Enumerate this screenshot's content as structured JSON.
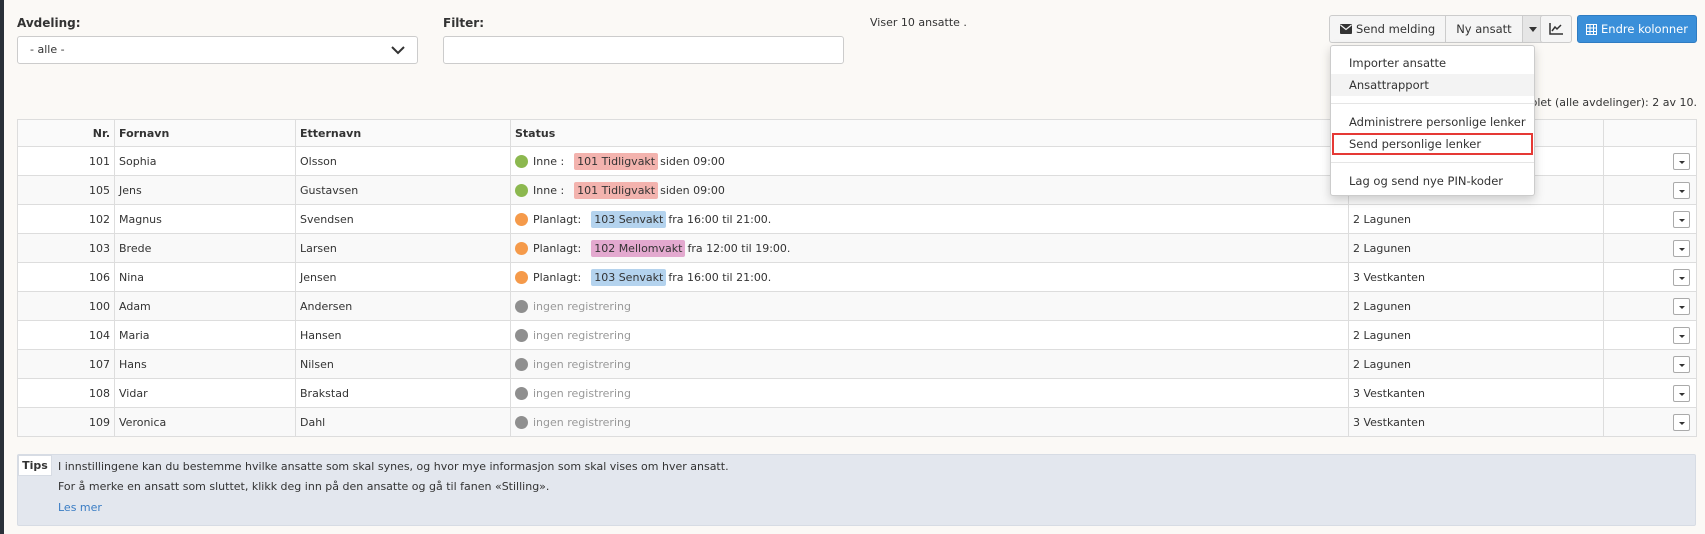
{
  "filters": {
    "department_label": "Avdeling:",
    "department_value": "- alle -",
    "filter_label": "Filter:",
    "filter_value": "",
    "count_text": "Viser 10 ansatte ."
  },
  "toolbar": {
    "send_message": "Send melding",
    "new_employee": "Ny ansatt",
    "edit_columns": "Endre kolonner"
  },
  "complete_text": "plet (alle avdelinger): 2 av 10.",
  "dropdown": {
    "items": [
      "Importer ansatte",
      "Ansattrapport",
      "Administrere personlige lenker",
      "Send personlige lenker",
      "Lag og send nye PIN-koder"
    ]
  },
  "table": {
    "headers": [
      "Nr.",
      "Fornavn",
      "Etternavn",
      "Status",
      "",
      ""
    ],
    "rows": [
      {
        "nr": "101",
        "first": "Sophia",
        "last": "Olsson",
        "status_label": "Inne :",
        "tag": "101 Tidligvakt",
        "tag_color": "#f3b3ae",
        "detail": "siden 09:00",
        "dot": "#8cb84f",
        "dept": ""
      },
      {
        "nr": "105",
        "first": "Jens",
        "last": "Gustavsen",
        "status_label": "Inne :",
        "tag": "101 Tidligvakt",
        "tag_color": "#f3b3ae",
        "detail": "siden 09:00",
        "dot": "#8cb84f",
        "dept": ""
      },
      {
        "nr": "102",
        "first": "Magnus",
        "last": "Svendsen",
        "status_label": "Planlagt:",
        "tag": "103 Senvakt",
        "tag_color": "#b4d3ee",
        "detail": "fra 16:00 til 21:00.",
        "dot": "#f59a4a",
        "dept": "2 Lagunen"
      },
      {
        "nr": "103",
        "first": "Brede",
        "last": "Larsen",
        "status_label": "Planlagt:",
        "tag": "102 Mellomvakt",
        "tag_color": "#e3a9cf",
        "detail": "fra 12:00 til 19:00.",
        "dot": "#f59a4a",
        "dept": "2 Lagunen"
      },
      {
        "nr": "106",
        "first": "Nina",
        "last": "Jensen",
        "status_label": "Planlagt:",
        "tag": "103 Senvakt",
        "tag_color": "#b4d3ee",
        "detail": "fra 16:00 til 21:00.",
        "dot": "#f59a4a",
        "dept": "3 Vestkanten"
      },
      {
        "nr": "100",
        "first": "Adam",
        "last": "Andersen",
        "status_label": "ingen registrering",
        "tag": "",
        "tag_color": "",
        "detail": "",
        "dot": "#8f8f8f",
        "dept": "2 Lagunen"
      },
      {
        "nr": "104",
        "first": "Maria",
        "last": "Hansen",
        "status_label": "ingen registrering",
        "tag": "",
        "tag_color": "",
        "detail": "",
        "dot": "#8f8f8f",
        "dept": "2 Lagunen"
      },
      {
        "nr": "107",
        "first": "Hans",
        "last": "Nilsen",
        "status_label": "ingen registrering",
        "tag": "",
        "tag_color": "",
        "detail": "",
        "dot": "#8f8f8f",
        "dept": "2 Lagunen"
      },
      {
        "nr": "108",
        "first": "Vidar",
        "last": "Brakstad",
        "status_label": "ingen registrering",
        "tag": "",
        "tag_color": "",
        "detail": "",
        "dot": "#8f8f8f",
        "dept": "3 Vestkanten"
      },
      {
        "nr": "109",
        "first": "Veronica",
        "last": "Dahl",
        "status_label": "ingen registrering",
        "tag": "",
        "tag_color": "",
        "detail": "",
        "dot": "#8f8f8f",
        "dept": "3 Vestkanten"
      }
    ]
  },
  "tips": {
    "badge": "Tips",
    "line1": "I innstillingene kan du bestemme hvilke ansatte som skal synes, og hvor mye informasjon som skal vises om hver ansatt.",
    "line2": "For å merke en ansatt som sluttet, klikk deg inn på den ansatte og gå til fanen «Stilling».",
    "link": "Les mer"
  }
}
